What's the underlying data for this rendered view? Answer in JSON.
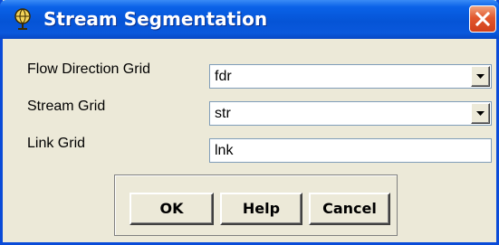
{
  "window": {
    "title": "Stream Segmentation",
    "colors": {
      "titlebar": "#0554d6",
      "close_button": "#e2582d",
      "dialog_bg": "#ece9d8"
    }
  },
  "form": {
    "flow_direction": {
      "label": "Flow Direction Grid",
      "value": "fdr"
    },
    "stream_grid": {
      "label": "Stream Grid",
      "value": "str"
    },
    "link_grid": {
      "label": "Link Grid",
      "value": "lnk"
    }
  },
  "buttons": {
    "ok": "OK",
    "help": "Help",
    "cancel": "Cancel"
  },
  "icons": [
    "app-globe-icon",
    "close-x-icon",
    "dropdown-arrow-icon"
  ]
}
